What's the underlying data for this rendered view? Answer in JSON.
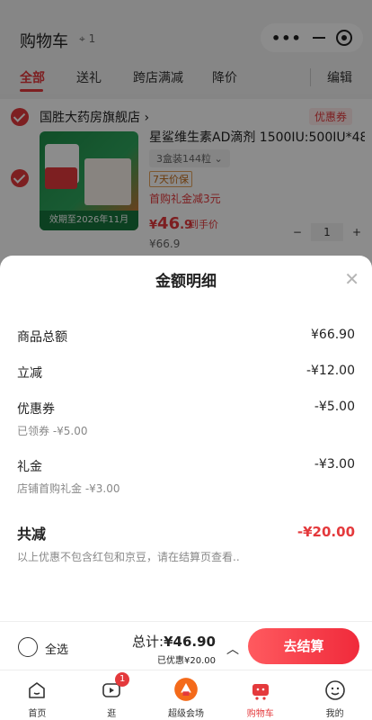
{
  "header": {
    "title": "购物车",
    "location_count": "1"
  },
  "tabs": [
    "全部",
    "送礼",
    "跨店满减",
    "降价"
  ],
  "edit_label": "编辑",
  "store": {
    "name": "国胜大药房旗舰店",
    "coupon_tag": "优惠券"
  },
  "product": {
    "name": "星鲨维生素AD滴剂 1500IU:500IU*48",
    "spec": "3盒装144粒",
    "tag": "7天价保",
    "gift_note": "首购礼金减3元",
    "price_yen": "¥",
    "price_int": "46",
    "price_dec": ".9",
    "price_note": "到手价",
    "orig_price": "¥66.9",
    "qty": "1",
    "image_expiry": "效期至2026年11月"
  },
  "sheet": {
    "title": "金额明细",
    "rows": [
      {
        "label": "商品总额",
        "value": "¥66.90"
      },
      {
        "label": "立减",
        "value": "-¥12.00"
      },
      {
        "label": "优惠券",
        "value": "-¥5.00",
        "sub": "已领券 -¥5.00"
      },
      {
        "label": "礼金",
        "value": "-¥3.00",
        "sub": "店铺首购礼金 -¥3.00"
      }
    ],
    "total_label": "共减",
    "total_value": "-¥20.00",
    "disclaimer": "以上优惠不包含红包和京豆，请在结算页查看.."
  },
  "checkout": {
    "select_all": "全选",
    "total_prefix": "总计:",
    "total_value": "¥46.90",
    "saved": "已优惠¥20.00",
    "button": "去结算"
  },
  "tabbar": [
    {
      "label": "首页",
      "icon": "home-icon"
    },
    {
      "label": "逛",
      "icon": "play-icon",
      "badge": "1"
    },
    {
      "label": "超级会场",
      "icon": "venue-icon"
    },
    {
      "label": "购物车",
      "icon": "cart-icon",
      "active": true
    },
    {
      "label": "我的",
      "icon": "profile-icon"
    }
  ],
  "colors": {
    "accent": "#e4393c",
    "overlay": "rgba(0,0,0,0.45)"
  }
}
